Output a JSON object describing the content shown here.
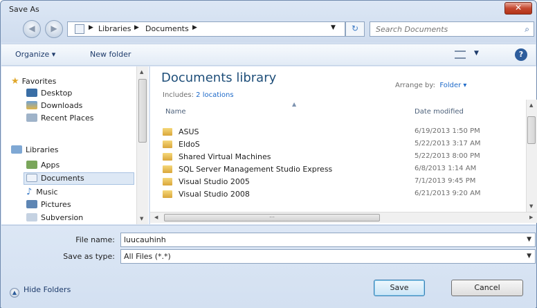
{
  "window": {
    "title": "Save As"
  },
  "address": {
    "crumbs": [
      "Libraries",
      "Documents"
    ]
  },
  "search": {
    "placeholder": "Search Documents"
  },
  "toolbar": {
    "organize": "Organize ▾",
    "new_folder": "New folder"
  },
  "nav": {
    "favorites": "Favorites",
    "desktop": "Desktop",
    "downloads": "Downloads",
    "recent": "Recent Places",
    "libraries": "Libraries",
    "apps": "Apps",
    "documents": "Documents",
    "music": "Music",
    "pictures": "Pictures",
    "subversion": "Subversion"
  },
  "library": {
    "title": "Documents library",
    "includes_label": "Includes:",
    "includes_link": "2 locations",
    "arrange_label": "Arrange by:",
    "arrange_value": "Folder ▾"
  },
  "columns": {
    "name": "Name",
    "date": "Date modified"
  },
  "files": [
    {
      "name": "ASUS",
      "date": "6/19/2013 1:50 PM"
    },
    {
      "name": "EldoS",
      "date": "5/22/2013 3:17 AM"
    },
    {
      "name": "Shared Virtual Machines",
      "date": "5/22/2013 8:00 PM"
    },
    {
      "name": "SQL Server Management Studio Express",
      "date": "6/8/2013 1:14 AM"
    },
    {
      "name": "Visual Studio 2005",
      "date": "7/1/2013 9:45 PM"
    },
    {
      "name": "Visual Studio 2008",
      "date": "6/21/2013 9:20 AM"
    }
  ],
  "form": {
    "filename_label": "File name:",
    "filename_value": "luucauhinh",
    "savetype_label": "Save as type:",
    "savetype_value": "All Files (*.*)"
  },
  "buttons": {
    "hide_folders": "Hide Folders",
    "save": "Save",
    "cancel": "Cancel"
  },
  "colors": {
    "accent": "#1e6ac9",
    "title_blue": "#1e4e79",
    "close_red": "#c4482f",
    "folder_yellow": "#e6b84a"
  }
}
